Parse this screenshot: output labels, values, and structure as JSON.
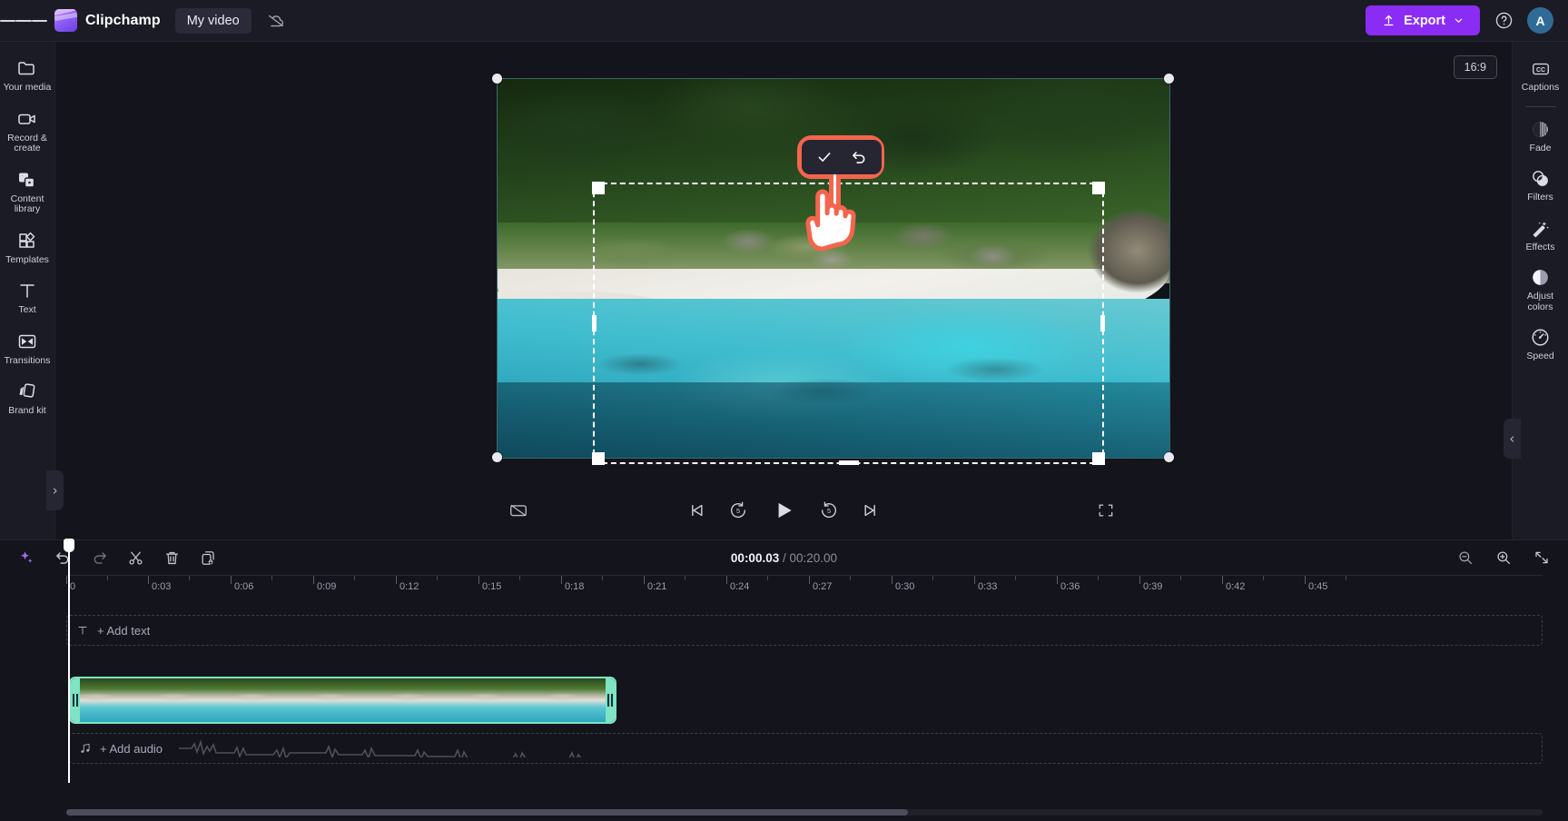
{
  "topbar": {
    "menu_icon": "hamburger-menu-icon",
    "brand": "Clipchamp",
    "project_name": "My video",
    "cloud_icon": "cloud-off-icon",
    "export_label": "Export",
    "export_icon": "upload-icon",
    "export_chevron": "chevron-down-icon",
    "help_icon": "question-circle-icon",
    "avatar_initial": "A"
  },
  "left_rail": {
    "items": [
      {
        "label": "Your media",
        "icon": "folder-icon"
      },
      {
        "label": "Record & create",
        "icon": "video-camera-icon"
      },
      {
        "label": "Content library",
        "icon": "content-library-icon"
      },
      {
        "label": "Templates",
        "icon": "templates-grid-icon"
      },
      {
        "label": "Text",
        "icon": "text-t-icon"
      },
      {
        "label": "Transitions",
        "icon": "transitions-icon"
      },
      {
        "label": "Brand kit",
        "icon": "brand-kit-icon"
      }
    ],
    "collapse_icon": "chevron-right-icon"
  },
  "right_rail": {
    "items": [
      {
        "label": "Captions",
        "icon": "closed-captions-icon"
      },
      {
        "label": "Fade",
        "icon": "fade-icon"
      },
      {
        "label": "Filters",
        "icon": "filters-icon"
      },
      {
        "label": "Effects",
        "icon": "magic-wand-icon"
      },
      {
        "label": "Adjust colors",
        "icon": "contrast-icon"
      },
      {
        "label": "Speed",
        "icon": "speedometer-icon"
      }
    ],
    "collapse_icon": "chevron-left-icon"
  },
  "stage": {
    "aspect_ratio": "16:9",
    "crop_tools": {
      "confirm_icon": "checkmark-icon",
      "reset_icon": "undo-arrow-icon"
    },
    "annotation": {
      "highlight_color": "#f4654e",
      "cursor_icon": "pointing-hand-cursor"
    }
  },
  "player": {
    "captions_toggle_icon": "captions-off-icon",
    "skip_start_icon": "skip-to-start-icon",
    "back5_icon": "rewind-5-seconds-icon",
    "play_icon": "play-icon",
    "forward5_icon": "forward-5-seconds-icon",
    "skip_end_icon": "skip-to-end-icon",
    "fullscreen_icon": "fullscreen-icon"
  },
  "timeline": {
    "toolbar": {
      "ai_icon": "sparkle-ai-icon",
      "undo_icon": "undo-icon",
      "redo_icon": "redo-icon",
      "split_icon": "scissors-split-icon",
      "delete_icon": "trash-delete-icon",
      "duplicate_icon": "duplicate-clip-icon",
      "zoom_out_icon": "zoom-out-icon",
      "zoom_in_icon": "zoom-in-icon",
      "fit_icon": "fit-to-screen-icon",
      "expand_icon": "chevron-down-icon"
    },
    "current_time": "00:00.03",
    "separator": "/",
    "total_time": "00:20.00",
    "ruler_labels": [
      "0",
      "0:03",
      "0:06",
      "0:09",
      "0:12",
      "0:15",
      "0:18",
      "0:21",
      "0:24",
      "0:27",
      "0:30",
      "0:33",
      "0:36",
      "0:39",
      "0:42",
      "0:45"
    ],
    "text_track": {
      "label": "+ Add text",
      "icon": "text-t-icon"
    },
    "audio_track": {
      "label": "+ Add audio",
      "icon": "music-note-icon"
    },
    "clip": {
      "name": "video-clip",
      "selection_color": "#7fe3c4",
      "thumbnail_count": 7
    }
  }
}
